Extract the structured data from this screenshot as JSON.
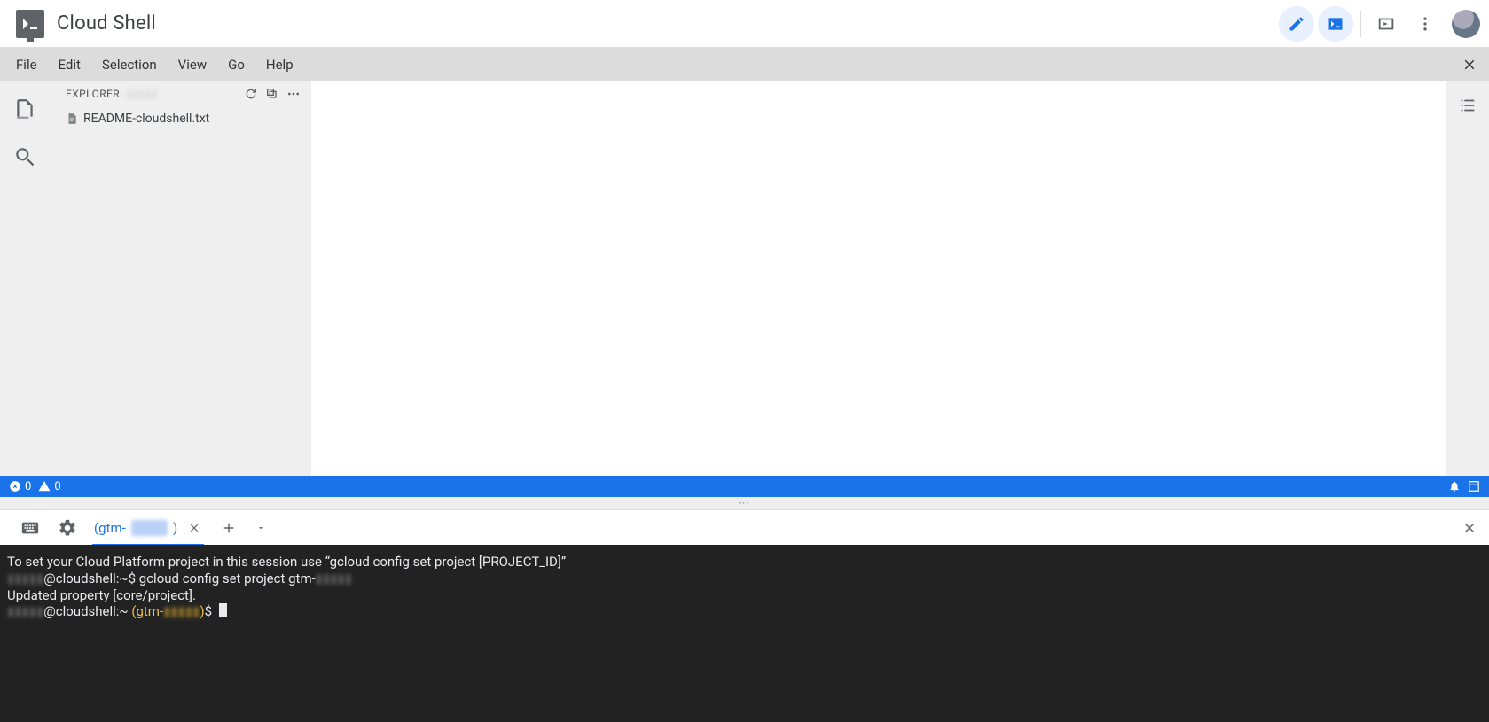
{
  "header": {
    "title": "Cloud Shell"
  },
  "menu": {
    "items": [
      "File",
      "Edit",
      "Selection",
      "View",
      "Go",
      "Help"
    ]
  },
  "explorer": {
    "label": "EXPLORER:",
    "project": "▮▮▮▮▮",
    "files": [
      "README-cloudshell.txt"
    ]
  },
  "status": {
    "errors": "0",
    "warnings": "0"
  },
  "terminal": {
    "tab_prefix": "(gtm-",
    "tab_redacted": "▮▮▮▮▮",
    "tab_suffix": ")",
    "lines": {
      "l1": "To set your Cloud Platform project in this session use “gcloud config set project [PROJECT_ID]”",
      "l2_user": "▮▮▮▮▮",
      "l2_host": "@cloudshell:",
      "l2_path": "~",
      "l2_dollar": "$ ",
      "l2_cmd": "gcloud config set project gtm-",
      "l2_proj": "▮▮▮▮▮",
      "l3": "Updated property [core/project].",
      "l4_user": "▮▮▮▮▮",
      "l4_host": "@cloudshell:",
      "l4_path": "~",
      "l4_open": " (gtm-",
      "l4_proj": "▮▮▮▮▮",
      "l4_close": ")",
      "l4_dollar": "$ "
    }
  }
}
